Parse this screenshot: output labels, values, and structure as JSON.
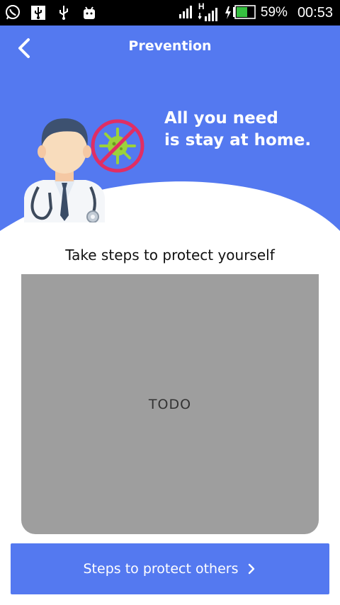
{
  "status_bar": {
    "battery": "59%",
    "time": "00:53",
    "network": "H",
    "icons": [
      "whatsapp-icon",
      "usb-icon",
      "usb-icon",
      "android-icon",
      "signal-icon",
      "signal-icon",
      "battery-icon"
    ]
  },
  "header": {
    "title": "Prevention",
    "tagline_line1": "All you need",
    "tagline_line2": "is stay at home."
  },
  "section": {
    "title": "Take steps to protect yourself",
    "placeholder": "TODO"
  },
  "footer_button": {
    "label": "Steps to protect others"
  },
  "colors": {
    "primary": "#5479f0",
    "placeholder_bg": "#9e9e9e",
    "virus": "#9bd23a",
    "prohibition": "#e02e64"
  }
}
